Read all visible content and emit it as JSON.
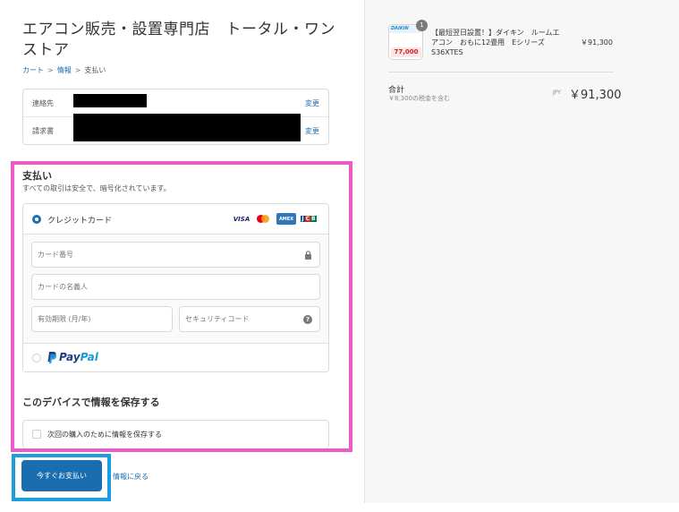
{
  "store": {
    "title": "エアコン販売・設置専門店　トータル・ワンストア"
  },
  "breadcrumb": {
    "items": [
      "カート",
      "情報",
      "支払い"
    ],
    "separator": ">"
  },
  "review": {
    "contact_label": "連絡先",
    "billing_label": "請求書",
    "change_label": "変更"
  },
  "payment": {
    "title": "支払い",
    "subtitle": "すべての取引は安全で、暗号化されています。",
    "credit_card_label": "クレジットカード",
    "card_logos": [
      "VISA",
      "Mastercard",
      "AMERICAN EXPRESS",
      "JCB"
    ],
    "card_number_placeholder": "カード番号",
    "card_name_placeholder": "カードの名義人",
    "expiry_placeholder": "有効期限 (月/年)",
    "security_placeholder": "セキュリティコード",
    "paypal_pay": "Pay",
    "paypal_pal": "Pal"
  },
  "save": {
    "title": "このデバイスで情報を保存する",
    "checkbox_label": "次回の購入のために情報を保存する"
  },
  "actions": {
    "pay_now": "今すぐお支払い",
    "back_to_info": "情報に戻る"
  },
  "summary": {
    "item_name": "【最短翌日設置！】ダイキン　ルームエアコン　おもに12畳用　Eシリーズ　S36XTES",
    "item_price": "￥91,300",
    "quantity_badge": "1",
    "thumb_brand": "DAIKIN",
    "thumb_price": "77,000",
    "total_label": "合計",
    "tax_note": "￥8,300の税金を含む",
    "currency": "JPY",
    "total_value": "￥91,300"
  },
  "colors": {
    "accent": "#1a6eb0",
    "highlight_pink": "#ec5bc6",
    "highlight_blue": "#1b9ee0"
  }
}
